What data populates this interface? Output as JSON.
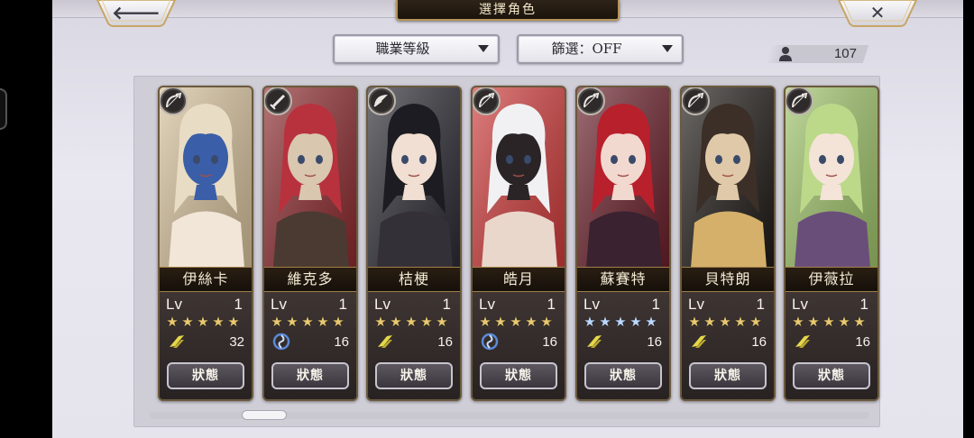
{
  "header": {
    "back_glyph": "🡐",
    "title": "選擇角色",
    "close_glyph": "✕"
  },
  "filters": {
    "sort_label": "職業等級",
    "filter_label": "篩選：OFF"
  },
  "roster_count": "107",
  "colors": {
    "gold_star": "#e8c870",
    "blue_star": "#bcd8ff",
    "wind_element": "#e6d84a",
    "water_element": "#5a8ad8"
  },
  "characters": [
    {
      "name": "伊絲卡",
      "lv_label": "Lv",
      "level": "1",
      "stars": 5,
      "star_color": "gold",
      "element": "wind-element-icon",
      "element_value": "32",
      "status_label": "狀態",
      "weapon": "bow-icon",
      "palette": [
        "#e9dcc4",
        "#d7c29c",
        "#3a5ea8",
        "#f1e6d8"
      ]
    },
    {
      "name": "維克多",
      "lv_label": "Lv",
      "level": "1",
      "stars": 5,
      "star_color": "gold",
      "element": "water-element-icon",
      "element_value": "16",
      "status_label": "狀態",
      "weapon": "sword-icon",
      "palette": [
        "#b8323e",
        "#8c2a2e",
        "#d9c7b0",
        "#4b3a31"
      ]
    },
    {
      "name": "桔梗",
      "lv_label": "Lv",
      "level": "1",
      "stars": 5,
      "star_color": "gold",
      "element": "wind-element-icon",
      "element_value": "16",
      "status_label": "狀態",
      "weapon": "fan-icon",
      "palette": [
        "#1c1c22",
        "#2b2b33",
        "#f0dfd2",
        "#343038"
      ]
    },
    {
      "name": "皓月",
      "lv_label": "Lv",
      "level": "1",
      "stars": 5,
      "star_color": "gold",
      "element": "water-element-icon",
      "element_value": "16",
      "status_label": "狀態",
      "weapon": "bow-icon",
      "palette": [
        "#f1f1f3",
        "#cf3b3b",
        "#2a2426",
        "#e9d7cb"
      ]
    },
    {
      "name": "蘇賽特",
      "lv_label": "Lv",
      "level": "1",
      "stars": 5,
      "star_color": "blue",
      "element": "wind-element-icon",
      "element_value": "16",
      "status_label": "狀態",
      "weapon": "bow-icon",
      "palette": [
        "#b8202c",
        "#6a1f2a",
        "#f2d9cf",
        "#3a2230"
      ]
    },
    {
      "name": "貝特朗",
      "lv_label": "Lv",
      "level": "1",
      "stars": 5,
      "star_color": "gold",
      "element": "wind-element-icon",
      "element_value": "16",
      "status_label": "狀態",
      "weapon": "bow-icon",
      "palette": [
        "#3b2f28",
        "#1f1a17",
        "#e0c9a8",
        "#d4b06a"
      ]
    },
    {
      "name": "伊薇拉",
      "lv_label": "Lv",
      "level": "1",
      "stars": 5,
      "star_color": "gold",
      "element": "wind-element-icon",
      "element_value": "16",
      "status_label": "狀態",
      "weapon": "bow-icon",
      "palette": [
        "#bcd98a",
        "#9fc46a",
        "#f4e4d8",
        "#6a4e7a"
      ]
    }
  ]
}
